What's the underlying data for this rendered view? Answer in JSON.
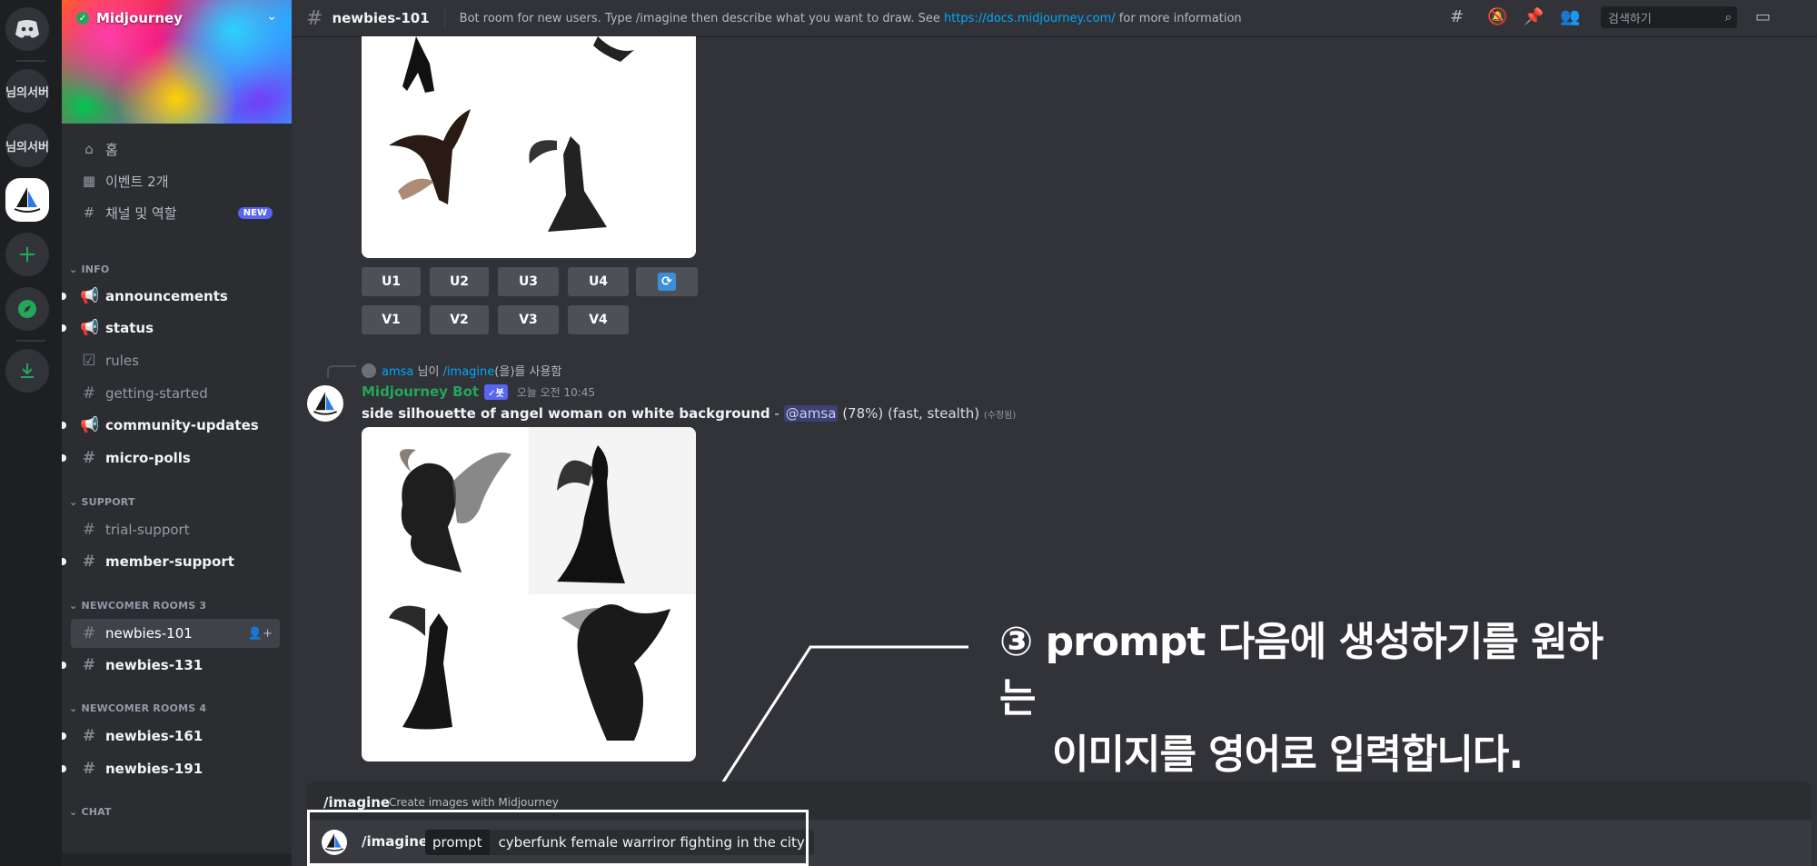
{
  "servers": {
    "discord_home": "discord-logo",
    "server1": "님의서버",
    "server2": "님의서버",
    "add_server": "+",
    "explore": "compass",
    "download": "download"
  },
  "sidebar": {
    "server_name": "Midjourney",
    "nav": [
      {
        "icon": "home-icon",
        "label": "홈"
      },
      {
        "icon": "calendar-icon",
        "label": "이벤트 2개"
      },
      {
        "icon": "channels-roles-icon",
        "label": "채널 및 역할",
        "badge": "NEW"
      }
    ],
    "categories": {
      "info": "INFO",
      "support": "SUPPORT",
      "newcomer3": "NEWCOMER ROOMS 3",
      "newcomer4": "NEWCOMER ROOMS 4",
      "chat": "CHAT"
    },
    "channels": {
      "announcements": "announcements",
      "status": "status",
      "rules": "rules",
      "getting_started": "getting-started",
      "community_updates": "community-updates",
      "micro_polls": "micro-polls",
      "trial_support": "trial-support",
      "member_support": "member-support",
      "newbies_101": "newbies-101",
      "newbies_131": "newbies-131",
      "newbies_161": "newbies-161",
      "newbies_191": "newbies-191"
    }
  },
  "topbar": {
    "channel": "newbies-101",
    "topic_prefix": "Bot room for new users. Type /imagine then describe what you want to draw. See ",
    "topic_link": "https://docs.midjourney.com/",
    "topic_suffix": " for more information",
    "search_placeholder": "검색하기"
  },
  "upscale_buttons": [
    "U1",
    "U2",
    "U3",
    "U4"
  ],
  "variation_buttons": [
    "V1",
    "V2",
    "V3",
    "V4"
  ],
  "message": {
    "reply_user": "amsa",
    "reply_mid": " 님이 ",
    "reply_cmd": "/imagine",
    "reply_suffix": "(을)를 사용함",
    "author": "Midjourney Bot",
    "bot_tag": "✓봇",
    "time": "오늘 오전 10:45",
    "prompt": "side silhouette of angel woman on white background",
    "dash": " - ",
    "mention": "@amsa",
    "status": " (78%) (fast, stealth) ",
    "edited": "(수정됨)"
  },
  "command_hint": {
    "command": "/imagine",
    "description": "Create images with Midjourney"
  },
  "composer": {
    "command": "/imagine",
    "option_key": "prompt",
    "option_value": "cyberfunk female warriror fighting in the city"
  },
  "annotation": {
    "line1": "③ prompt 다음에 생성하기를 원하는",
    "line2": "이미지를 영어로 입력합니다."
  }
}
